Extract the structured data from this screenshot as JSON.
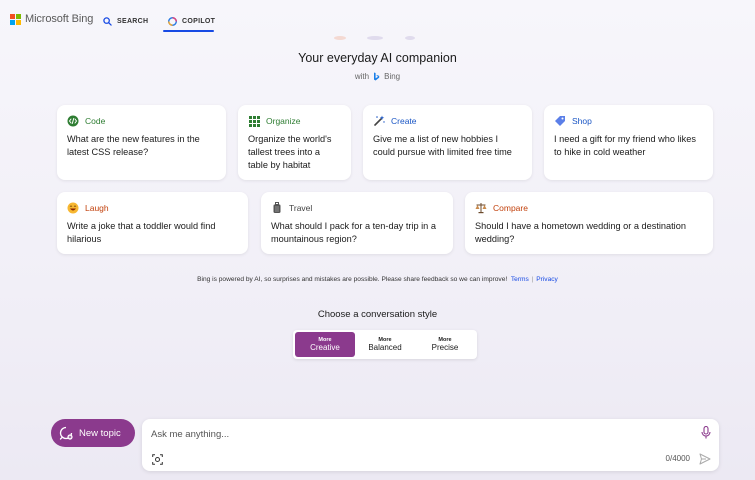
{
  "header": {
    "logo_text": "Microsoft Bing",
    "tabs": [
      {
        "label": "SEARCH",
        "icon": "search-icon"
      },
      {
        "label": "COPILOT",
        "icon": "copilot-icon",
        "active": true
      }
    ]
  },
  "hero": {
    "title": "Your everyday AI companion",
    "with_label": "with",
    "brand": "Bing"
  },
  "cards": [
    {
      "category": "Code",
      "icon": "code-icon",
      "color": "#2e7d32",
      "prompt": "What are the new features in the latest CSS release?"
    },
    {
      "category": "Organize",
      "icon": "grid-icon",
      "color": "#2e7d32",
      "prompt": "Organize the world's tallest trees into a table by habitat"
    },
    {
      "category": "Create",
      "icon": "magic-wand-icon",
      "color": "#1a56c5",
      "prompt": "Give me a list of new hobbies I could pursue with limited free time"
    },
    {
      "category": "Shop",
      "icon": "tag-icon",
      "color": "#1a56c5",
      "prompt": "I need a gift for my friend who likes to hike in cold weather"
    },
    {
      "category": "Laugh",
      "icon": "laughing-face-icon",
      "color": "#c2410c",
      "prompt": "Write a joke that a toddler would find hilarious"
    },
    {
      "category": "Travel",
      "icon": "luggage-icon",
      "color": "#444444",
      "prompt": "What should I pack for a ten-day trip in a mountainous region?"
    },
    {
      "category": "Compare",
      "icon": "scales-icon",
      "color": "#c2410c",
      "prompt": "Should I have a hometown wedding or a destination wedding?"
    }
  ],
  "disclaimer": {
    "text": "Bing is powered by AI, so surprises and mistakes are possible. Please share feedback so we can improve!",
    "terms": "Terms",
    "privacy": "Privacy"
  },
  "conversation_style": {
    "title": "Choose a conversation style",
    "options": [
      {
        "small": "More",
        "label": "Creative",
        "active": true
      },
      {
        "small": "More",
        "label": "Balanced",
        "active": false
      },
      {
        "small": "More",
        "label": "Precise",
        "active": false
      }
    ]
  },
  "composer": {
    "new_topic": "New topic",
    "placeholder": "Ask me anything...",
    "counter": "0/4000"
  },
  "colors": {
    "accent": "#8b3a8d",
    "link": "#174ae4"
  }
}
